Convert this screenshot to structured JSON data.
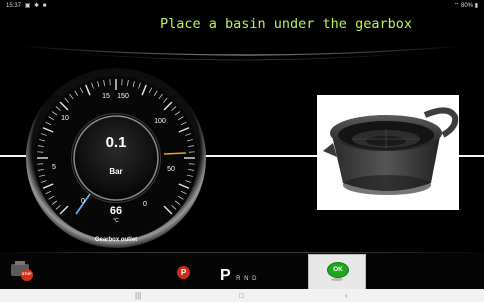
{
  "status_bar": {
    "time": "15:37",
    "icons": [
      "image-icon",
      "settings-icon",
      "square-icon"
    ],
    "battery_text": "80%",
    "battery_icon": "battery-icon",
    "signal_icon": "wifi-icon"
  },
  "instruction": "Place a basin under the gearbox",
  "gauge": {
    "value_label": "0.1",
    "unit_label": "Bar",
    "temperature": "66",
    "temperature_unit": "°C",
    "caption": "Gearbox outlet",
    "scale_labels": [
      "0",
      "5",
      "10",
      "15",
      "150",
      "100",
      "50",
      "0"
    ],
    "pressure_reading": 0.1,
    "accent_blue": "#6fb6ff",
    "accent_orange": "#f2a300"
  },
  "image": {
    "subject": "oil drain basin"
  },
  "toolbar": {
    "left_button_icon": "stop-engine-icon",
    "left_button_text": "STOP",
    "parking_icon": "parking-brake-icon",
    "parking_text": "P",
    "gear_selected": "P",
    "gear_others": "R N D",
    "ok_label": "OK",
    "ok_color": "#1aa31a"
  },
  "nav": {
    "recent": "|||",
    "home": "□",
    "back": "‹"
  }
}
